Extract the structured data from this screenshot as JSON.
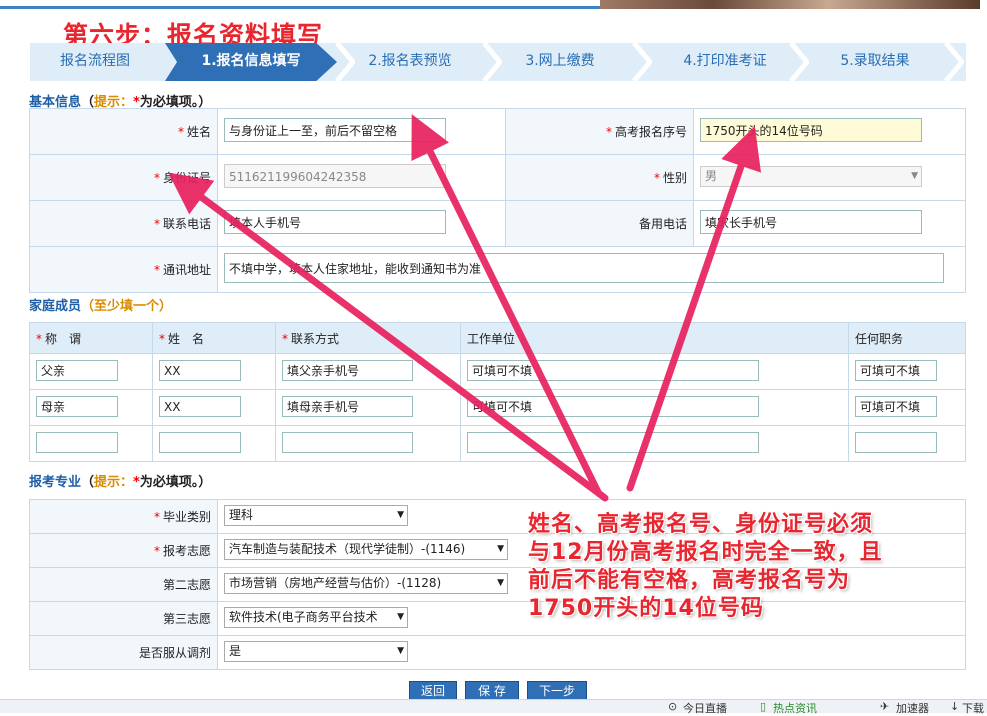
{
  "step_title": "第六步：报名资料填写",
  "flow": {
    "items": [
      "报名流程图",
      "1.报名信息填写",
      "2.报名表预览",
      "3.网上缴费",
      "4.打印准考证",
      "5.录取结果"
    ]
  },
  "basic": {
    "title": "基本信息",
    "hint_open": "（",
    "hint_label": "提示：",
    "hint_star": "*",
    "hint_text": "为必填项。）",
    "name_label": "姓名",
    "name_value": "与身份证上一至，前后不留空格",
    "exam_no_label": "高考报名序号",
    "exam_no_value": "1750开头的14位号码",
    "id_label": "身份证号",
    "id_value": "511621199604242358",
    "gender_label": "性别",
    "gender_value": "男",
    "phone_label": "联系电话",
    "phone_value": "填本人手机号",
    "backup_phone_label": "备用电话",
    "backup_phone_value": "填家长手机号",
    "address_label": "通讯地址",
    "address_value": "不填中学，填本人住家地址，能收到通知书为准",
    "star": "*"
  },
  "family": {
    "title": "家庭成员",
    "hint": "（至少填一个）",
    "headers": [
      "称　谓",
      "姓　名",
      "联系方式",
      "工作单位",
      "任何职务"
    ],
    "rows": [
      [
        "父亲",
        "XX",
        "填父亲手机号",
        "可填可不填",
        "可填可不填"
      ],
      [
        "母亲",
        "XX",
        "填母亲手机号",
        "可填可不填",
        "可填可不填"
      ],
      [
        "",
        "",
        "",
        "",
        ""
      ]
    ]
  },
  "major": {
    "title": "报考专业",
    "hint_open": "（",
    "hint_label": "提示：",
    "hint_star": "*",
    "hint_text": "为必填项。）",
    "grad_label": "毕业类别",
    "grad_value": "理科",
    "choice1_label": "报考志愿",
    "choice1_value": "汽车制造与装配技术（现代学徒制）-(1146)",
    "choice2_label": "第二志愿",
    "choice2_value": "市场营销（房地产经营与估价）-(1128)",
    "choice3_label": "第三志愿",
    "choice3_value": "软件技术(电子商务平台技术",
    "adjust_label": "是否服从调剂",
    "adjust_value": "是"
  },
  "buttons": {
    "back": "返回",
    "save": "保 存",
    "next": "下一步"
  },
  "annotation": {
    "lines": [
      "姓名、高考报名号、身份证号必须",
      "与12月份高考报名时完全一致，且",
      "前后不能有空格，高考报名号为",
      "1750开头的14位号码"
    ]
  },
  "statusbar": {
    "item1": "今日直播",
    "item2": "热点资讯",
    "item3": "加速器",
    "item4": "下载"
  },
  "colors": {
    "accent": "#2f6fb5",
    "annotation": "#e8262f",
    "hint": "#d98c00"
  }
}
